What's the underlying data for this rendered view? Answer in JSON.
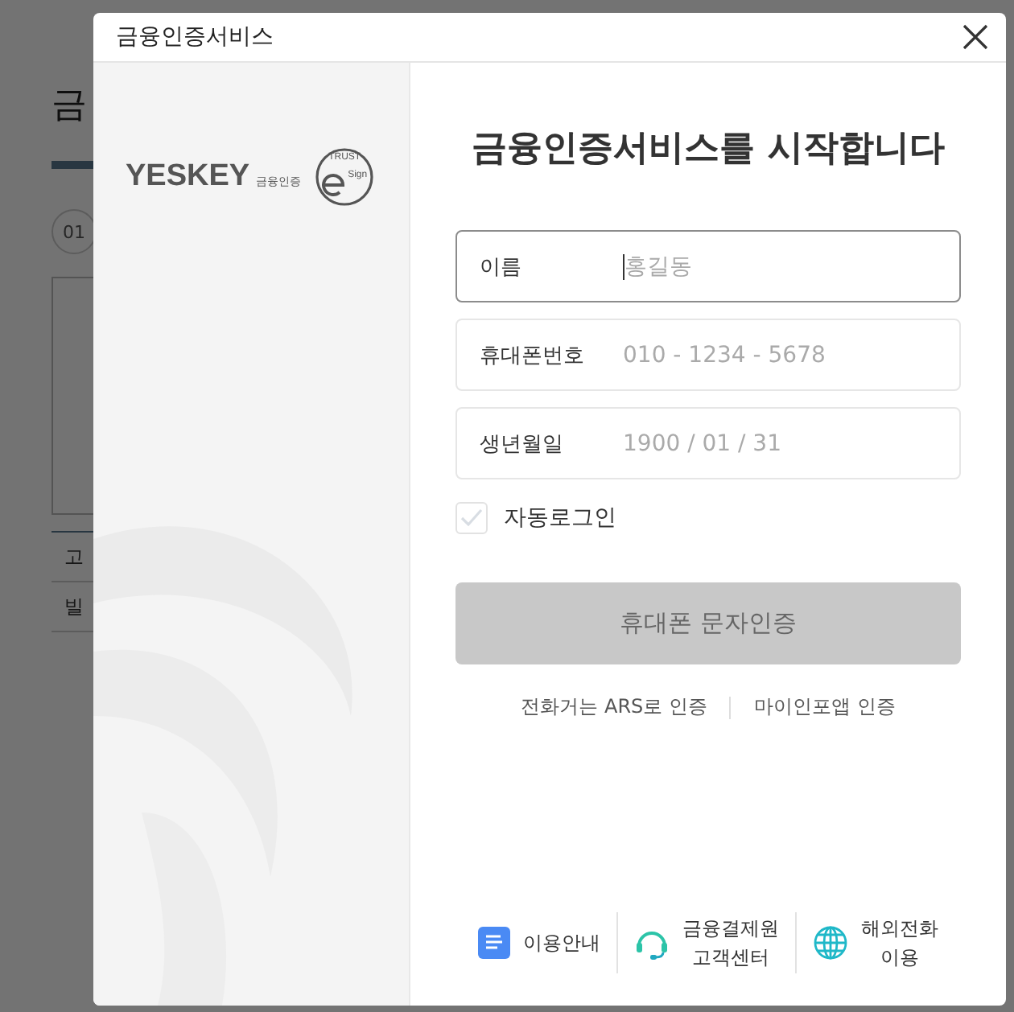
{
  "background_page": {
    "title_fragment": "금",
    "step": "01",
    "row_fragments": [
      "고",
      "빌"
    ]
  },
  "dialog": {
    "title": "금융인증서비스",
    "logo": {
      "brand": "YESKEY",
      "brand_sub": "금융인증",
      "seal_top": "TRUST",
      "seal_bottom": "Sign"
    },
    "heading": "금융인증서비스를 시작합니다",
    "fields": [
      {
        "label": "이름",
        "placeholder": "홍길동",
        "focused": true
      },
      {
        "label": "휴대폰번호",
        "placeholder": "010 - 1234 - 5678",
        "focused": false
      },
      {
        "label": "생년월일",
        "placeholder": "1900 / 01 / 31",
        "focused": false
      }
    ],
    "auto_login": {
      "label": "자동로그인",
      "checked": false
    },
    "submit": {
      "label": "휴대폰 문자인증",
      "disabled": true
    },
    "alt_links": [
      "전화거는 ARS로 인증",
      "마이인포앱 인증"
    ],
    "footer_links": [
      {
        "kind": "guide",
        "label": "이용안내"
      },
      {
        "kind": "support",
        "label": "금융결제원\n고객센터"
      },
      {
        "kind": "global",
        "label": "해외전화\n이용"
      }
    ]
  }
}
